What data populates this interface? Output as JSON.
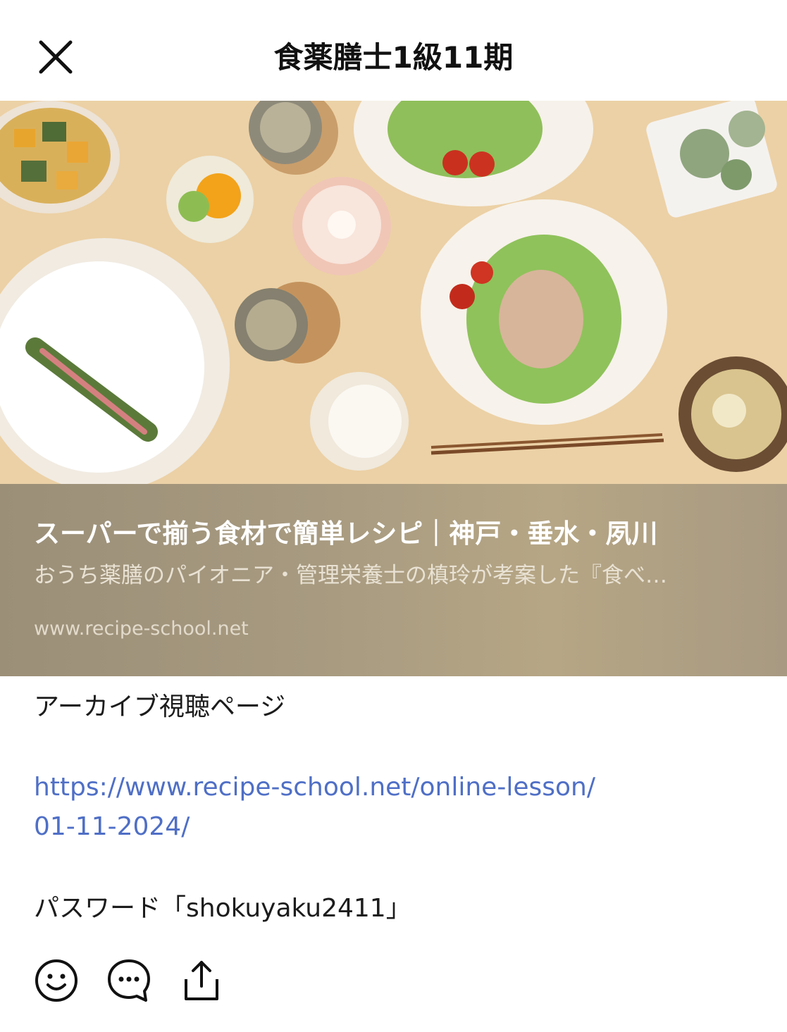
{
  "header": {
    "title": "食薬膳士1級11期",
    "close_icon": "close-icon"
  },
  "link_preview": {
    "title": "スーパーで揃う食材で簡単レシピ｜神戸・垂水・夙川",
    "description": "おうち薬膳のパイオニア・管理栄養士の槙玲が考案した『食べ…",
    "domain": "www.recipe-school.net",
    "image": "food-photo"
  },
  "message": {
    "line1": "アーカイブ視聴ページ",
    "url_line1": "https://www.recipe-school.net/online-lesson/",
    "url_line2": "01-11-2024/",
    "password_line": "パスワード「shokuyaku2411」"
  },
  "actions": [
    {
      "icon": "smiley-icon"
    },
    {
      "icon": "comment-icon"
    },
    {
      "icon": "share-icon"
    }
  ],
  "colors": {
    "link": "#4f6fc6",
    "overlay": "#a89a80"
  }
}
